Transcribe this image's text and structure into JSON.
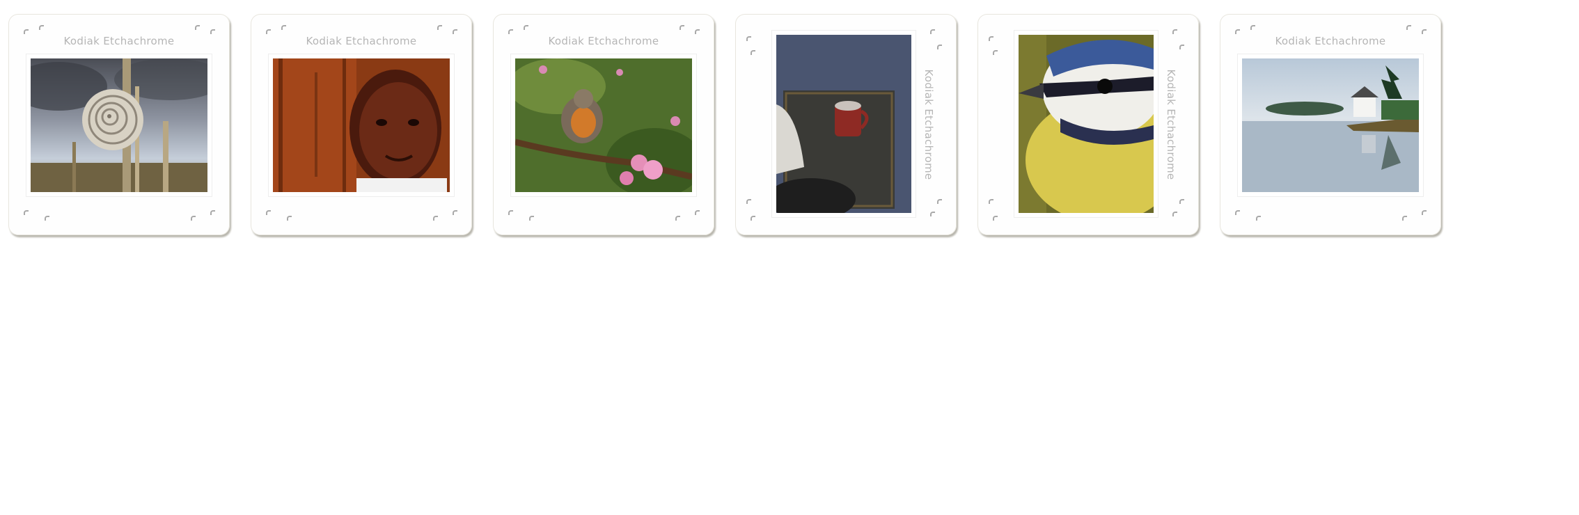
{
  "slides": [
    {
      "brand": "Kodiak Etchachrome",
      "photo_icon": "snail-photo"
    },
    {
      "brand": "Kodiak Etchachrome",
      "photo_icon": "child-portrait-photo"
    },
    {
      "brand": "Kodiak Etchachrome",
      "photo_icon": "robin-blossom-photo"
    },
    {
      "brand": "Kodiak Etchachrome",
      "photo_icon": "cup-on-tray-photo"
    },
    {
      "brand": "Kodiak Etchachrome",
      "photo_icon": "blue-tit-bird-photo"
    },
    {
      "brand": "Kodiak Etchachrome",
      "photo_icon": "lakeside-house-photo"
    }
  ]
}
